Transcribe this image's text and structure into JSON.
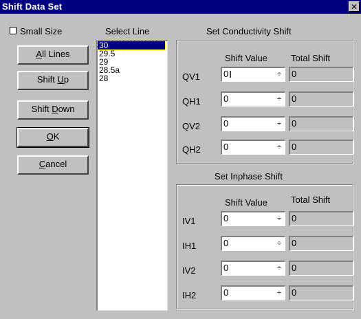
{
  "window": {
    "title": "Shift Data Set",
    "close_glyph": "✕"
  },
  "left": {
    "small_size_label": "Small Size",
    "buttons": [
      {
        "pre": "",
        "acc": "A",
        "post": "ll Lines"
      },
      {
        "pre": "Shift ",
        "acc": "U",
        "post": "p"
      },
      {
        "pre": "Shift ",
        "acc": "D",
        "post": "own"
      },
      {
        "pre": "",
        "acc": "O",
        "post": "K"
      },
      {
        "pre": "",
        "acc": "C",
        "post": "ancel"
      }
    ]
  },
  "select_line": {
    "label": "Select Line",
    "items": [
      "30",
      "29.5",
      "29",
      "28.5a",
      "28"
    ],
    "selected": "30"
  },
  "conductivity": {
    "title": "Set Conductivity Shift",
    "col_shift": "Shift Value",
    "col_total": "Total Shift",
    "rows": [
      {
        "label": "QV1",
        "shift": "0",
        "total": "0"
      },
      {
        "label": "QH1",
        "shift": "0",
        "total": "0"
      },
      {
        "label": "QV2",
        "shift": "0",
        "total": "0"
      },
      {
        "label": "QH2",
        "shift": "0",
        "total": "0"
      }
    ]
  },
  "inphase": {
    "title": "Set Inphase Shift",
    "col_shift": "Shift Value",
    "col_total": "Total Shift",
    "rows": [
      {
        "label": "IV1",
        "shift": "0",
        "total": "0"
      },
      {
        "label": "IH1",
        "shift": "0",
        "total": "0"
      },
      {
        "label": "IV2",
        "shift": "0",
        "total": "0"
      },
      {
        "label": "IH2",
        "shift": "0",
        "total": "0"
      }
    ]
  }
}
